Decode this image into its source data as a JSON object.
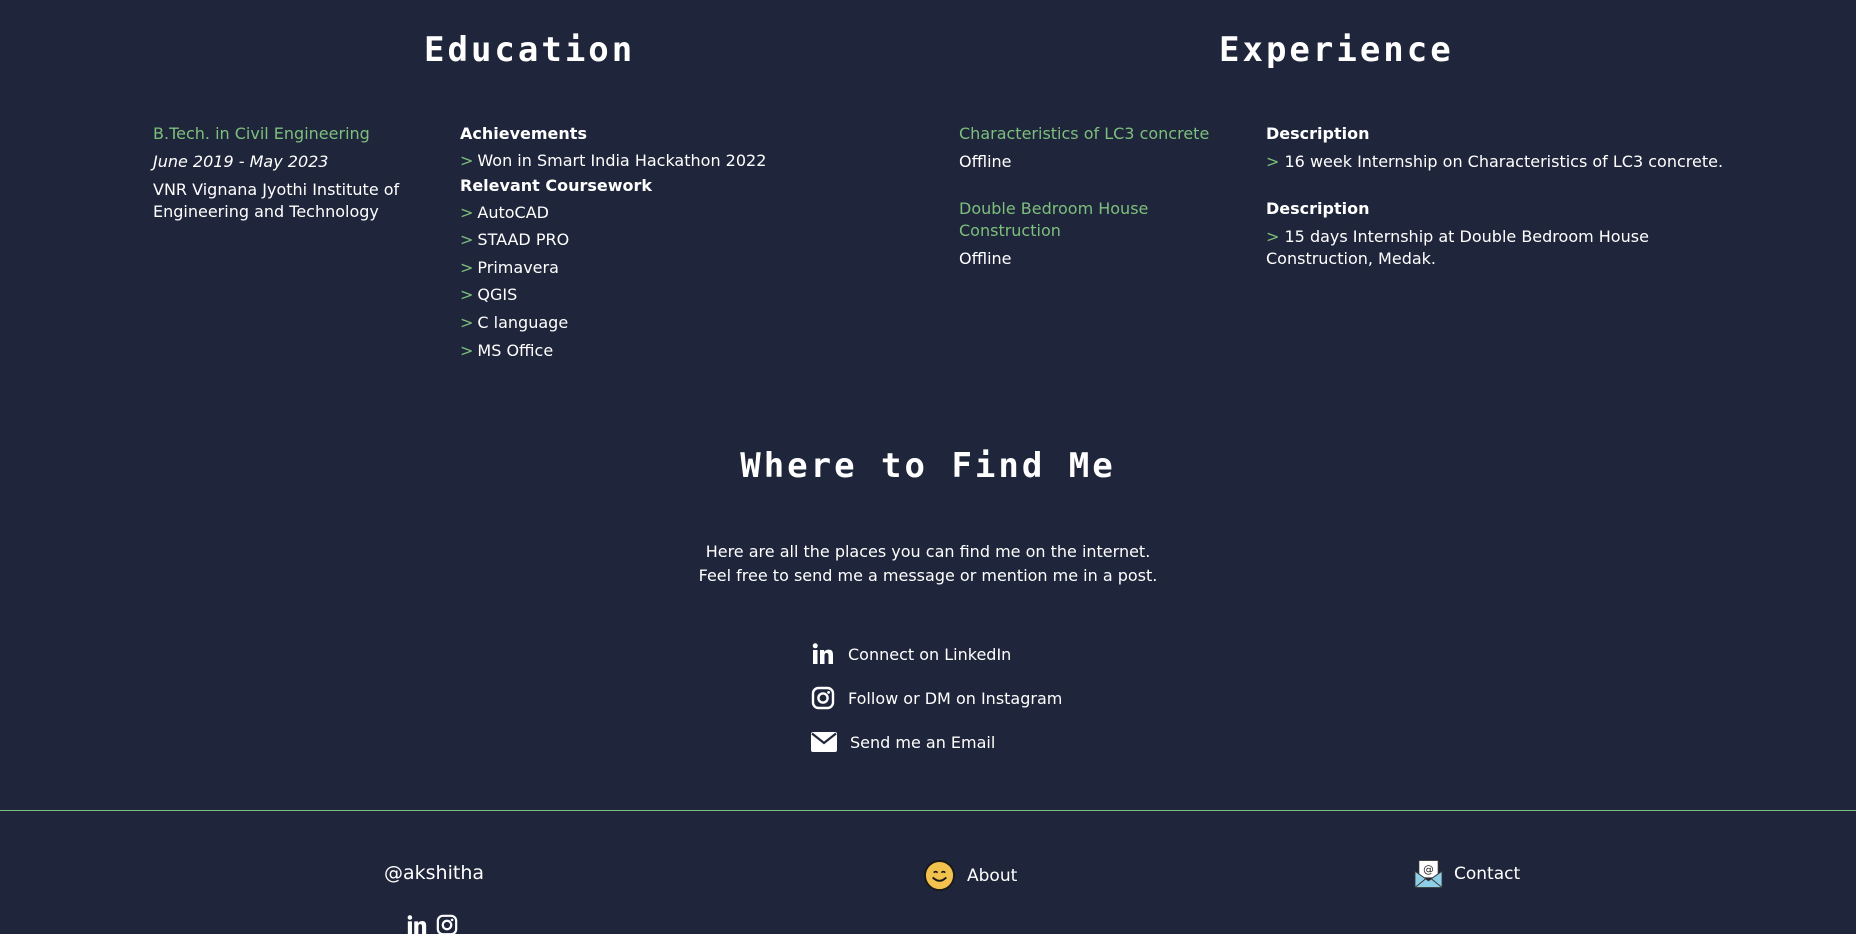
{
  "education": {
    "title": "Education",
    "degree": "B.Tech. in Civil Engineering",
    "dates": "June 2019 - May 2023",
    "institute_line1": "VNR Vignana Jyothi Institute of",
    "institute_line2": "Engineering and Technology",
    "achievements_heading": "Achievements",
    "achievements": [
      "Won in Smart India Hackathon 2022"
    ],
    "coursework_heading": "Relevant Coursework",
    "coursework": [
      "AutoCAD",
      "STAAD PRO",
      "Primavera",
      "QGIS",
      "C language",
      "MS Office"
    ],
    "bullet_marker": ">"
  },
  "experience": {
    "title": "Experience",
    "items": [
      {
        "title_line1": "Characteristics of LC3 concrete",
        "title_line2": "",
        "mode": "Offline",
        "desc_heading": "Description",
        "desc_line1": "16 week Internship on Characteristics of LC3 concrete.",
        "desc_line2": ""
      },
      {
        "title_line1": "Double Bedroom House",
        "title_line2": "Construction",
        "mode": "Offline",
        "desc_heading": "Description",
        "desc_line1": " 15 days Internship at Double Bedroom House",
        "desc_line2": "Construction, Medak."
      }
    ]
  },
  "find": {
    "title": "Where to Find Me",
    "line1": "Here are all the places you can find me on the internet.",
    "line2": "Feel free to send me a message or mention me in a post.",
    "links": [
      {
        "label": "Connect on LinkedIn",
        "icon": "linkedin-icon"
      },
      {
        "label": "Follow or DM on Instagram",
        "icon": "instagram-icon"
      },
      {
        "label": "Send me an Email",
        "icon": "mail-icon"
      }
    ]
  },
  "footer": {
    "handle": "@akshitha",
    "about": "About",
    "contact": "Contact"
  },
  "colors": {
    "background": "#1f253a",
    "accent": "#7dbf7d",
    "text": "#ffffff"
  }
}
